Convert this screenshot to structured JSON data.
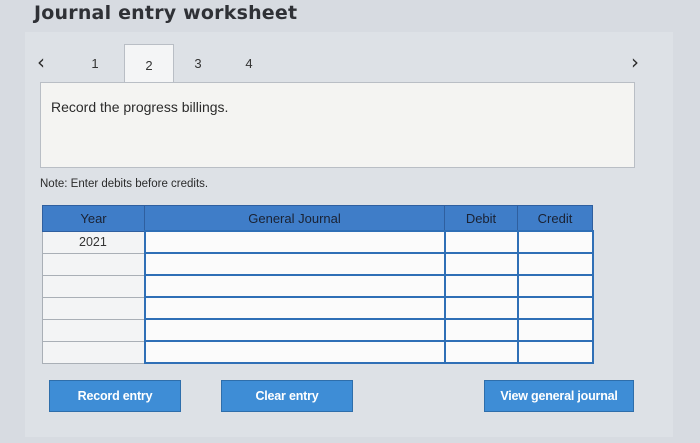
{
  "header": {
    "title": "Journal entry worksheet"
  },
  "nav": {
    "prev_icon": "chevron-left-icon",
    "next_icon": "chevron-right-icon",
    "tabs": [
      {
        "label": "1"
      },
      {
        "label": "2",
        "active": true
      },
      {
        "label": "3"
      },
      {
        "label": "4"
      }
    ]
  },
  "instruction": "Record the progress billings.",
  "note": "Note: Enter debits before credits.",
  "table": {
    "headers": {
      "year": "Year",
      "general_journal": "General Journal",
      "debit": "Debit",
      "credit": "Credit"
    },
    "rows": [
      {
        "year": "2021",
        "general_journal": "",
        "debit": "",
        "credit": ""
      },
      {
        "year": "",
        "general_journal": "",
        "debit": "",
        "credit": ""
      },
      {
        "year": "",
        "general_journal": "",
        "debit": "",
        "credit": ""
      },
      {
        "year": "",
        "general_journal": "",
        "debit": "",
        "credit": ""
      },
      {
        "year": "",
        "general_journal": "",
        "debit": "",
        "credit": ""
      },
      {
        "year": "",
        "general_journal": "",
        "debit": "",
        "credit": ""
      }
    ]
  },
  "buttons": {
    "record": "Record entry",
    "clear": "Clear entry",
    "view": "View general journal"
  },
  "colors": {
    "header_blue": "#3f7dc8",
    "button_blue": "#3e8dd6"
  }
}
